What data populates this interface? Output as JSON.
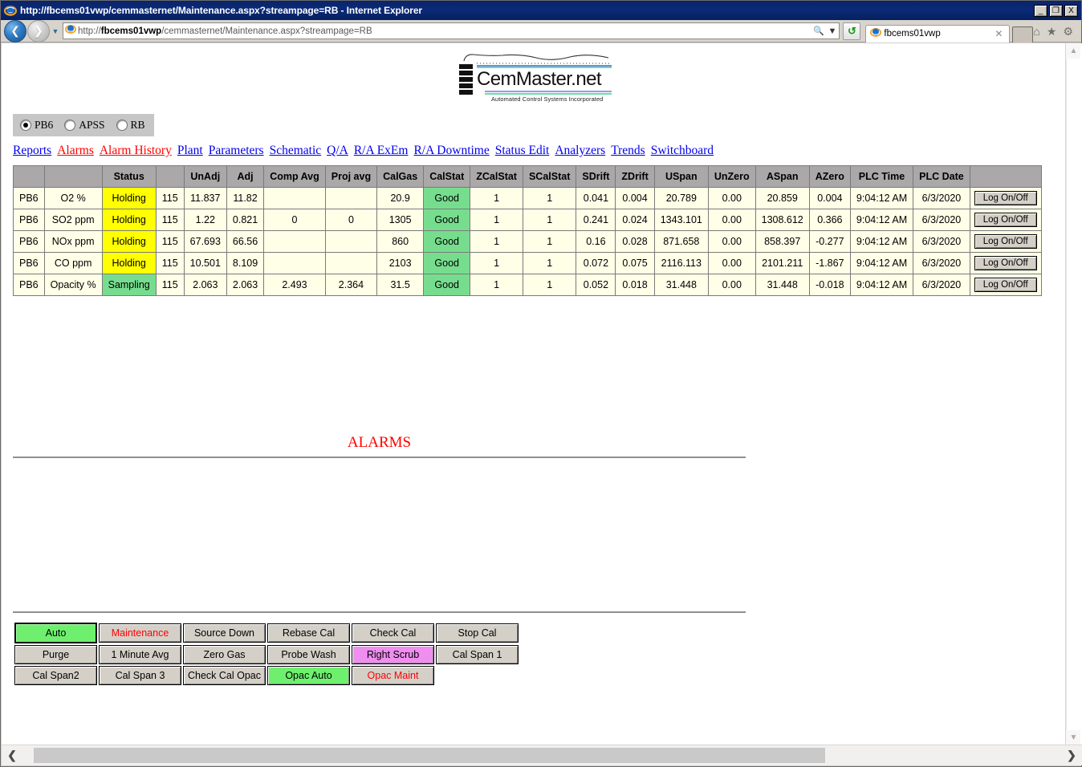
{
  "window": {
    "title": "http://fbcems01vwp/cemmasternet/Maintenance.aspx?streampage=RB - Internet Explorer",
    "minimize_label": "_",
    "maximize_label": "❐",
    "close_label": "X"
  },
  "browser": {
    "back_icon": "back-arrow-icon",
    "forward_icon": "forward-arrow-icon",
    "history_icon": "chevron-down-icon",
    "address_url": "http://fbcems01vwp/cemmasternet/Maintenance.aspx?streampage=RB",
    "address_host": "fbcems01vwp",
    "address_prefix": "http://",
    "address_suffix": "/cemmasternet/Maintenance.aspx?streampage=RB",
    "search_icon": "search-icon",
    "dropdown_icon": "dropdown-icon",
    "refresh_icon": "refresh-icon",
    "tab_label": "fbcems01vwp",
    "tab_close_icon": "close-icon",
    "new_tab_label": "",
    "home_icon": "home-icon",
    "favorites_icon": "star-icon",
    "tools_icon": "gear-icon"
  },
  "logo": {
    "name": "CemMaster.net",
    "tagline": "Automated Control Systems Incorporated"
  },
  "stream_selector": {
    "options": [
      {
        "label": "PB6",
        "selected": true
      },
      {
        "label": "APSS",
        "selected": false
      },
      {
        "label": "RB",
        "selected": false
      }
    ]
  },
  "nav": {
    "links": [
      {
        "label": "Reports",
        "color": "blue"
      },
      {
        "label": "Alarms",
        "color": "red"
      },
      {
        "label": "Alarm History",
        "color": "red"
      },
      {
        "label": "Plant",
        "color": "blue"
      },
      {
        "label": "Parameters",
        "color": "blue"
      },
      {
        "label": "Schematic",
        "color": "blue"
      },
      {
        "label": "Q/A",
        "color": "blue"
      },
      {
        "label": "R/A ExEm",
        "color": "blue"
      },
      {
        "label": "R/A Downtime",
        "color": "blue"
      },
      {
        "label": "Status Edit",
        "color": "blue"
      },
      {
        "label": "Analyzers",
        "color": "blue"
      },
      {
        "label": "Trends",
        "color": "blue"
      },
      {
        "label": "Switchboard",
        "color": "blue"
      }
    ]
  },
  "table": {
    "headers": [
      "",
      "",
      "Status",
      "",
      "UnAdj",
      "Adj",
      "Comp Avg",
      "Proj avg",
      "CalGas",
      "CalStat",
      "ZCalStat",
      "SCalStat",
      "SDrift",
      "ZDrift",
      "USpan",
      "UnZero",
      "ASpan",
      "AZero",
      "PLC Time",
      "PLC Date",
      ""
    ],
    "button_label": "Log On/Off",
    "rows": [
      {
        "stream": "PB6",
        "param": "O2 %",
        "status": "Holding",
        "status_type": "holding",
        "num": "115",
        "unadj": "11.837",
        "adj": "11.82",
        "comp_avg": "",
        "proj_avg": "",
        "calgas": "20.9",
        "calstat": "Good",
        "zcalstat": "1",
        "scalstat": "1",
        "sdrift": "0.041",
        "zdrift": "0.004",
        "uspan": "20.789",
        "unzero": "0.00",
        "aspan": "20.859",
        "azero": "0.004",
        "plc_time": "9:04:12 AM",
        "plc_date": "6/3/2020"
      },
      {
        "stream": "PB6",
        "param": "SO2 ppm",
        "status": "Holding",
        "status_type": "holding",
        "num": "115",
        "unadj": "1.22",
        "adj": "0.821",
        "comp_avg": "0",
        "proj_avg": "0",
        "calgas": "1305",
        "calstat": "Good",
        "zcalstat": "1",
        "scalstat": "1",
        "sdrift": "0.241",
        "zdrift": "0.024",
        "uspan": "1343.101",
        "unzero": "0.00",
        "aspan": "1308.612",
        "azero": "0.366",
        "plc_time": "9:04:12 AM",
        "plc_date": "6/3/2020"
      },
      {
        "stream": "PB6",
        "param": "NOx ppm",
        "status": "Holding",
        "status_type": "holding",
        "num": "115",
        "unadj": "67.693",
        "adj": "66.56",
        "comp_avg": "",
        "proj_avg": "",
        "calgas": "860",
        "calstat": "Good",
        "zcalstat": "1",
        "scalstat": "1",
        "sdrift": "0.16",
        "zdrift": "0.028",
        "uspan": "871.658",
        "unzero": "0.00",
        "aspan": "858.397",
        "azero": "-0.277",
        "plc_time": "9:04:12 AM",
        "plc_date": "6/3/2020"
      },
      {
        "stream": "PB6",
        "param": "CO ppm",
        "status": "Holding",
        "status_type": "holding",
        "num": "115",
        "unadj": "10.501",
        "adj": "8.109",
        "comp_avg": "",
        "proj_avg": "",
        "calgas": "2103",
        "calstat": "Good",
        "zcalstat": "1",
        "scalstat": "1",
        "sdrift": "0.072",
        "zdrift": "0.075",
        "uspan": "2116.113",
        "unzero": "0.00",
        "aspan": "2101.211",
        "azero": "-1.867",
        "plc_time": "9:04:12 AM",
        "plc_date": "6/3/2020"
      },
      {
        "stream": "PB6",
        "param": "Opacity %",
        "status": "Sampling",
        "status_type": "sampling",
        "num": "115",
        "unadj": "2.063",
        "adj": "2.063",
        "comp_avg": "2.493",
        "proj_avg": "2.364",
        "calgas": "31.5",
        "calstat": "Good",
        "zcalstat": "1",
        "scalstat": "1",
        "sdrift": "0.052",
        "zdrift": "0.018",
        "uspan": "31.448",
        "unzero": "0.00",
        "aspan": "31.448",
        "azero": "-0.018",
        "plc_time": "9:04:12 AM",
        "plc_date": "6/3/2020"
      }
    ]
  },
  "alarms": {
    "title": "ALARMS",
    "entries": []
  },
  "controls": {
    "rows": [
      [
        {
          "label": "Auto",
          "style": "green-selected"
        },
        {
          "label": "Maintenance",
          "style": "red-text"
        },
        {
          "label": "Source Down",
          "style": "default"
        },
        {
          "label": "Rebase Cal",
          "style": "default"
        },
        {
          "label": "Check Cal",
          "style": "default"
        },
        {
          "label": "Stop Cal",
          "style": "default"
        }
      ],
      [
        {
          "label": "Purge",
          "style": "default"
        },
        {
          "label": "1 Minute Avg",
          "style": "default"
        },
        {
          "label": "Zero Gas",
          "style": "default"
        },
        {
          "label": "Probe Wash",
          "style": "default"
        },
        {
          "label": "Right Scrub",
          "style": "pink"
        },
        {
          "label": "Cal Span 1",
          "style": "default"
        }
      ],
      [
        {
          "label": "Cal Span2",
          "style": "default"
        },
        {
          "label": "Cal Span 3",
          "style": "default"
        },
        {
          "label": "Check Cal Opac",
          "style": "default"
        },
        {
          "label": "Opac Auto",
          "style": "green"
        },
        {
          "label": "Opac Maint",
          "style": "red-text"
        },
        {
          "label": "",
          "style": "empty"
        }
      ]
    ]
  },
  "scrollbars": {
    "v_up_icon": "chevron-up-icon",
    "v_down_icon": "chevron-down-icon",
    "h_left_icon": "chevron-left-icon",
    "h_right_icon": "chevron-right-icon"
  },
  "colors": {
    "title_bar": "#0a246a",
    "holding": "#ffff00",
    "good": "#77dd8e",
    "table_bg": "#ffffe8",
    "header_bg": "#aaa8a8",
    "link_blue": "#0000ee",
    "link_red": "#ff0000",
    "pink": "#ef8eef",
    "green": "#6ef06e"
  }
}
